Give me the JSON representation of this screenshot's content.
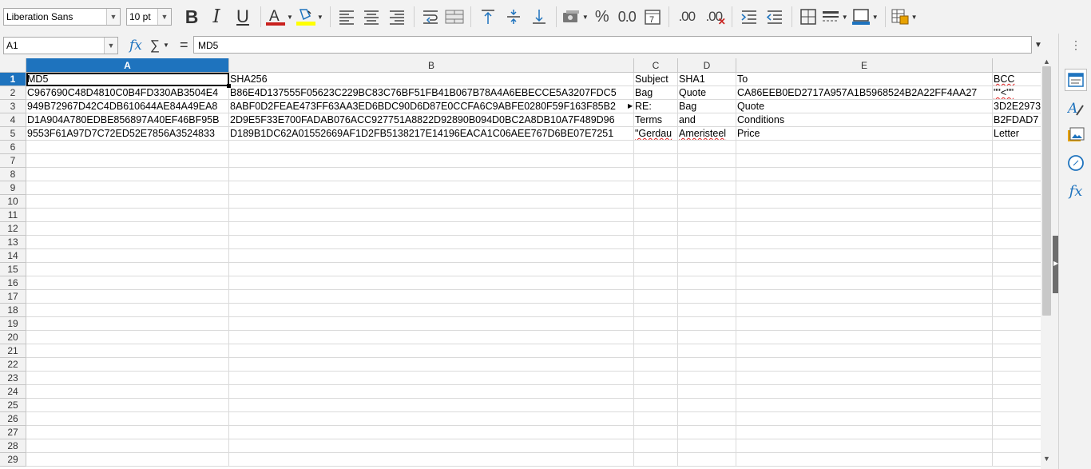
{
  "toolbar": {
    "font_name": "Liberation Sans",
    "font_size": "10 pt",
    "percent_label": "%",
    "number_label": "0.0",
    "add_decimal_label": ".00",
    "delete_decimal_label": ".00"
  },
  "formula_bar": {
    "name_box": "A1",
    "content": "MD5"
  },
  "colors": {
    "selection": "#1e73be",
    "font_color_bar": "#c9211e",
    "highlight_bar": "#ffff00",
    "spellcheck": "#e02020"
  },
  "grid": {
    "columns": [
      "A",
      "B",
      "C",
      "D",
      "E"
    ],
    "selected_column": "A",
    "selected_row": "1",
    "row_numbers": [
      "1",
      "2",
      "3",
      "4",
      "5",
      "6",
      "7",
      "8",
      "9",
      "10",
      "11",
      "12",
      "13",
      "14",
      "15",
      "16",
      "17",
      "18",
      "19",
      "20",
      "21",
      "22",
      "23",
      "24",
      "25",
      "26",
      "27",
      "28",
      "29"
    ],
    "rows": [
      {
        "A": "MD5",
        "B": "SHA256",
        "C": "Subject",
        "D": "SHA1",
        "E": "To",
        "F": "BCC"
      },
      {
        "A": "C967690C48D4810C0B4FD330AB3504E4",
        "B": "B86E4D137555F05623C229BC83C76BF51FB41B067B78A4A6EBECCE5A3207FDC5",
        "C": "Bag",
        "D": "Quote",
        "E": "CA86EEB0ED2717A957A1B5968524B2A22FF4AA27",
        "F": "\"\"<\"\""
      },
      {
        "A": "949B72967D42C4DB610644AE84A49EA8",
        "B": "8ABF0D2FEAE473FF63AA3ED6BDC90D6D87E0CCFA6C9ABFE0280F59F163F85B2",
        "C": "RE:",
        "D": "Bag",
        "E": "Quote",
        "F": "3D2E2973"
      },
      {
        "A": "D1A904A780EDBE856897A40EF46BF95B",
        "B": "2D9E5F33E700FADAB076ACC927751A8822D92890B094D0BC2A8DB10A7F489D96",
        "C": "Terms",
        "D": "and",
        "E": "Conditions",
        "F": "B2FDAD7"
      },
      {
        "A": "9553F61A97D7C72ED52E7856A3524833",
        "B": "D189B1DC62A01552669AF1D2FB5138217E14196EACA1C06AEE767D6BE07E7251",
        "C": "\"Gerdau",
        "D": "Ameristeel",
        "E": "Price",
        "F": "Letter"
      }
    ]
  }
}
